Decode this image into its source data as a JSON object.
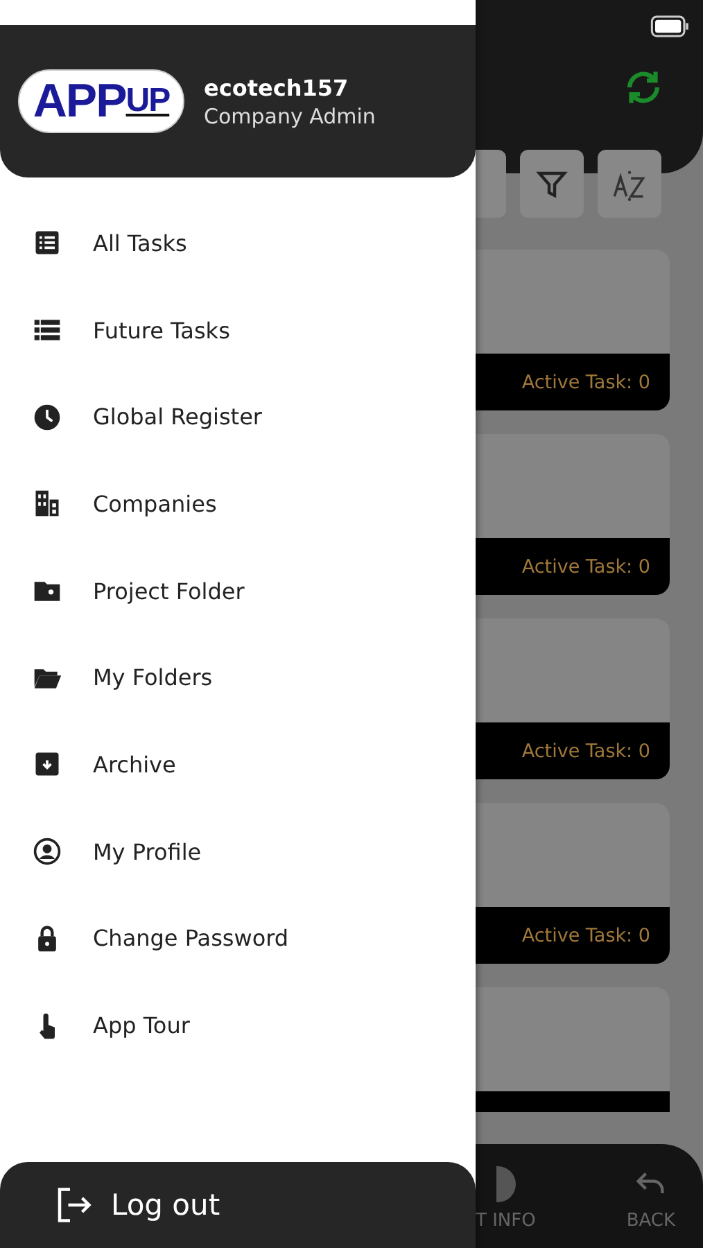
{
  "drawer": {
    "logo": {
      "text": "APP",
      "accent": "UP"
    },
    "username": "ecotech157",
    "role": "Company Admin",
    "menu": [
      {
        "label": "All Tasks"
      },
      {
        "label": "Future Tasks"
      },
      {
        "label": "Global Register"
      },
      {
        "label": "Companies"
      },
      {
        "label": "Project Folder"
      },
      {
        "label": "My Folders"
      },
      {
        "label": "Archive"
      },
      {
        "label": "My Profile"
      },
      {
        "label": "Change Password"
      },
      {
        "label": "App Tour"
      }
    ],
    "logout": "Log out"
  },
  "screen": {
    "cards": [
      {
        "kind": "full",
        "status": "Active Task: 0"
      },
      {
        "kind": "full",
        "status": "Active Task: 0"
      },
      {
        "kind": "full",
        "status": "Active Task: 0"
      },
      {
        "kind": "full",
        "status": "Active Task: 0"
      },
      {
        "kind": "partial"
      }
    ],
    "bottom_nav": [
      {
        "label": "T INFO"
      },
      {
        "label": "BACK"
      }
    ]
  }
}
